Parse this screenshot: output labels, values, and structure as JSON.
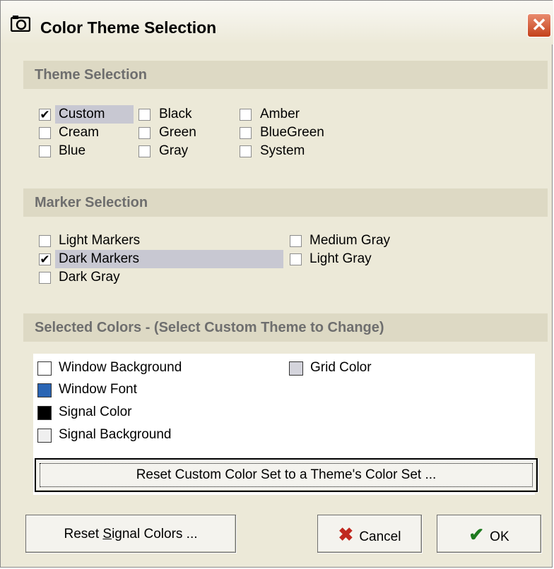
{
  "window": {
    "title": "Color Theme Selection",
    "close_glyph": "✕",
    "app_icon": "camera-icon"
  },
  "theme_section": {
    "header": "Theme Selection",
    "options": [
      {
        "label": "Custom",
        "checked": true
      },
      {
        "label": "Black",
        "checked": false
      },
      {
        "label": "Amber",
        "checked": false
      },
      {
        "label": "Cream",
        "checked": false
      },
      {
        "label": "Green",
        "checked": false
      },
      {
        "label": "BlueGreen",
        "checked": false
      },
      {
        "label": "Blue",
        "checked": false
      },
      {
        "label": "Gray",
        "checked": false
      },
      {
        "label": "System",
        "checked": false
      }
    ]
  },
  "marker_section": {
    "header": "Marker Selection",
    "options": [
      {
        "label": "Light Markers",
        "checked": false
      },
      {
        "label": "Medium Gray",
        "checked": false
      },
      {
        "label": "Dark Markers",
        "checked": true
      },
      {
        "label": "Light Gray",
        "checked": false
      },
      {
        "label": "Dark Gray",
        "checked": false
      }
    ]
  },
  "colors_section": {
    "header": "Selected Colors - (Select Custom Theme to Change)",
    "items": [
      {
        "label": "Window Background",
        "color": "#ffffff"
      },
      {
        "label": "Grid Color",
        "color": "#d4d4dc"
      },
      {
        "label": "Window Font",
        "color": "#2a65b4"
      },
      {
        "label": "Signal Color",
        "color": "#000000"
      },
      {
        "label": "Signal Background",
        "color": "#efefef"
      }
    ],
    "reset_custom_label": "Reset Custom Color Set to a Theme's Color Set ..."
  },
  "buttons": {
    "reset_signal_pre": "Reset ",
    "reset_signal_accel": "S",
    "reset_signal_post": "ignal Colors ...",
    "cancel_label": "Cancel",
    "ok_label": "OK",
    "cancel_icon": "x-icon",
    "ok_icon": "checkmark-icon"
  }
}
